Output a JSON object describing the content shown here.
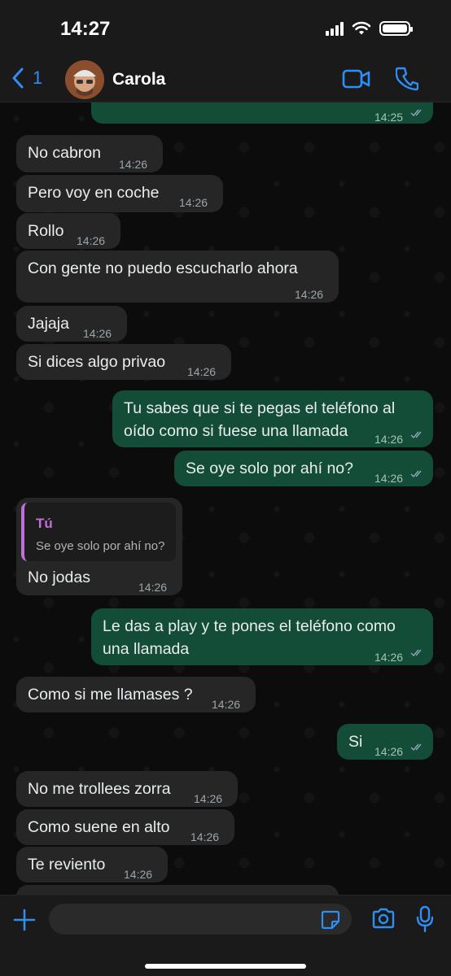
{
  "status_bar": {
    "time": "14:27"
  },
  "header": {
    "back_count": "1",
    "contact_name": "Carola"
  },
  "messages": [
    {
      "dir": "out",
      "text": "",
      "time": "14:25",
      "read": true
    },
    {
      "dir": "in",
      "text": "No cabron",
      "time": "14:26"
    },
    {
      "dir": "in",
      "text": "Pero voy en coche",
      "time": "14:26"
    },
    {
      "dir": "in",
      "text": "Rollo",
      "time": "14:26"
    },
    {
      "dir": "in",
      "text": "Con gente no puedo escucharlo ahora",
      "time": "14:26"
    },
    {
      "dir": "in",
      "text": "Jajaja",
      "time": "14:26"
    },
    {
      "dir": "in",
      "text": "Si dices algo privao",
      "time": "14:26"
    },
    {
      "dir": "out",
      "text_line1": "Tu sabes que si te pegas el teléfono al",
      "text_line2": "oído como si fuese una llamada",
      "time": "14:26",
      "read": true
    },
    {
      "dir": "out",
      "text": "Se oye solo por ahí no?",
      "time": "14:26",
      "read": true
    },
    {
      "dir": "in",
      "quote_author": "Tú",
      "quote_text": "Se oye solo por ahí no?",
      "text": "No jodas",
      "time": "14:26"
    },
    {
      "dir": "out",
      "text_line1": "Le das a play y te pones el teléfono como",
      "text_line2": "una llamada",
      "time": "14:26",
      "read": true
    },
    {
      "dir": "in",
      "text": "Como si me llamases ?",
      "time": "14:26"
    },
    {
      "dir": "out",
      "text": "Si",
      "time": "14:26",
      "read": true
    },
    {
      "dir": "in",
      "text": "No me trollees zorra",
      "time": "14:26"
    },
    {
      "dir": "in",
      "text": "Como suene en alto",
      "time": "14:26"
    },
    {
      "dir": "in",
      "text": "Te reviento",
      "time": "14:26"
    }
  ],
  "composer": {
    "placeholder": ""
  },
  "colors": {
    "accent": "#2f8ef4",
    "outgoing": "#134d37",
    "incoming": "#262626",
    "quote_bar": "#c16fd9"
  },
  "icons": [
    "back-chevron-icon",
    "video-call-icon",
    "phone-icon",
    "plus-icon",
    "sticker-icon",
    "camera-icon",
    "microphone-icon",
    "read-ticks-icon"
  ]
}
